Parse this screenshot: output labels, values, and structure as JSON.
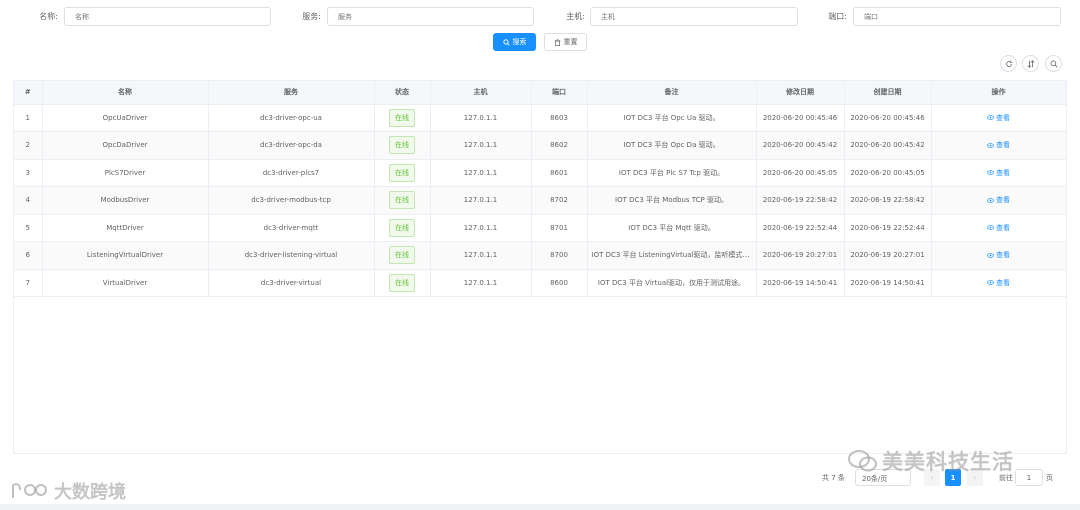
{
  "filters": [
    {
      "label": "名称:",
      "placeholder": "名称"
    },
    {
      "label": "服务:",
      "placeholder": "服务"
    },
    {
      "label": "主机:",
      "placeholder": "主机"
    },
    {
      "label": "端口:",
      "placeholder": "端口"
    }
  ],
  "buttons": {
    "search": "搜索",
    "reset": "重置"
  },
  "colors": {
    "primary": "#1890ff",
    "success": "#67c23a"
  },
  "table": {
    "headers": [
      "#",
      "名称",
      "服务",
      "状态",
      "主机",
      "端口",
      "备注",
      "修改日期",
      "创建日期",
      "操作"
    ],
    "rows": [
      {
        "idx": "1",
        "name": "OpcUaDriver",
        "service": "dc3-driver-opc-ua",
        "status": "在线",
        "host": "127.0.1.1",
        "port": "8603",
        "note": "IOT DC3 平台 Opc Ua 驱动。",
        "modified": "2020-06-20 00:45:46",
        "created": "2020-06-20 00:45:46",
        "action": "查看"
      },
      {
        "idx": "2",
        "name": "OpcDaDriver",
        "service": "dc3-driver-opc-da",
        "status": "在线",
        "host": "127.0.1.1",
        "port": "8602",
        "note": "IOT DC3 平台 Opc Da 驱动。",
        "modified": "2020-06-20 00:45:42",
        "created": "2020-06-20 00:45:42",
        "action": "查看"
      },
      {
        "idx": "3",
        "name": "PlcS7Driver",
        "service": "dc3-driver-plcs7",
        "status": "在线",
        "host": "127.0.1.1",
        "port": "8601",
        "note": "IOT DC3 平台 Plc S7 Tcp 驱动。",
        "modified": "2020-06-20 00:45:05",
        "created": "2020-06-20 00:45:05",
        "action": "查看"
      },
      {
        "idx": "4",
        "name": "ModbusDriver",
        "service": "dc3-driver-modbus-tcp",
        "status": "在线",
        "host": "127.0.1.1",
        "port": "8702",
        "note": "IOT DC3 平台 Modbus TCP 驱动。",
        "modified": "2020-06-19 22:58:42",
        "created": "2020-06-19 22:58:42",
        "action": "查看"
      },
      {
        "idx": "5",
        "name": "MqttDriver",
        "service": "dc3-driver-mqtt",
        "status": "在线",
        "host": "127.0.1.1",
        "port": "8701",
        "note": "IOT DC3 平台 Mqtt 驱动。",
        "modified": "2020-06-19 22:52:44",
        "created": "2020-06-19 22:52:44",
        "action": "查看"
      },
      {
        "idx": "6",
        "name": "ListeningVirtualDriver",
        "service": "dc3-driver-listening-virtual",
        "status": "在线",
        "host": "127.0.1.1",
        "port": "8700",
        "note": "IOT DC3 平台 ListeningVirtual驱动，监听模式，...",
        "modified": "2020-06-19 20:27:01",
        "created": "2020-06-19 20:27:01",
        "action": "查看"
      },
      {
        "idx": "7",
        "name": "VirtualDriver",
        "service": "dc3-driver-virtual",
        "status": "在线",
        "host": "127.0.1.1",
        "port": "8600",
        "note": "IOT DC3 平台 Virtual驱动，仅用于测试用途。",
        "modified": "2020-06-19 14:50:41",
        "created": "2020-06-19 14:50:41",
        "action": "查看"
      }
    ]
  },
  "pagination": {
    "total": "共 7 条",
    "page_size": "20条/页",
    "current": "1",
    "goto": "前往",
    "goto_value": "1",
    "unit": "页"
  },
  "watermarks": {
    "right": "美美科技生活",
    "left": "大数跨境"
  }
}
